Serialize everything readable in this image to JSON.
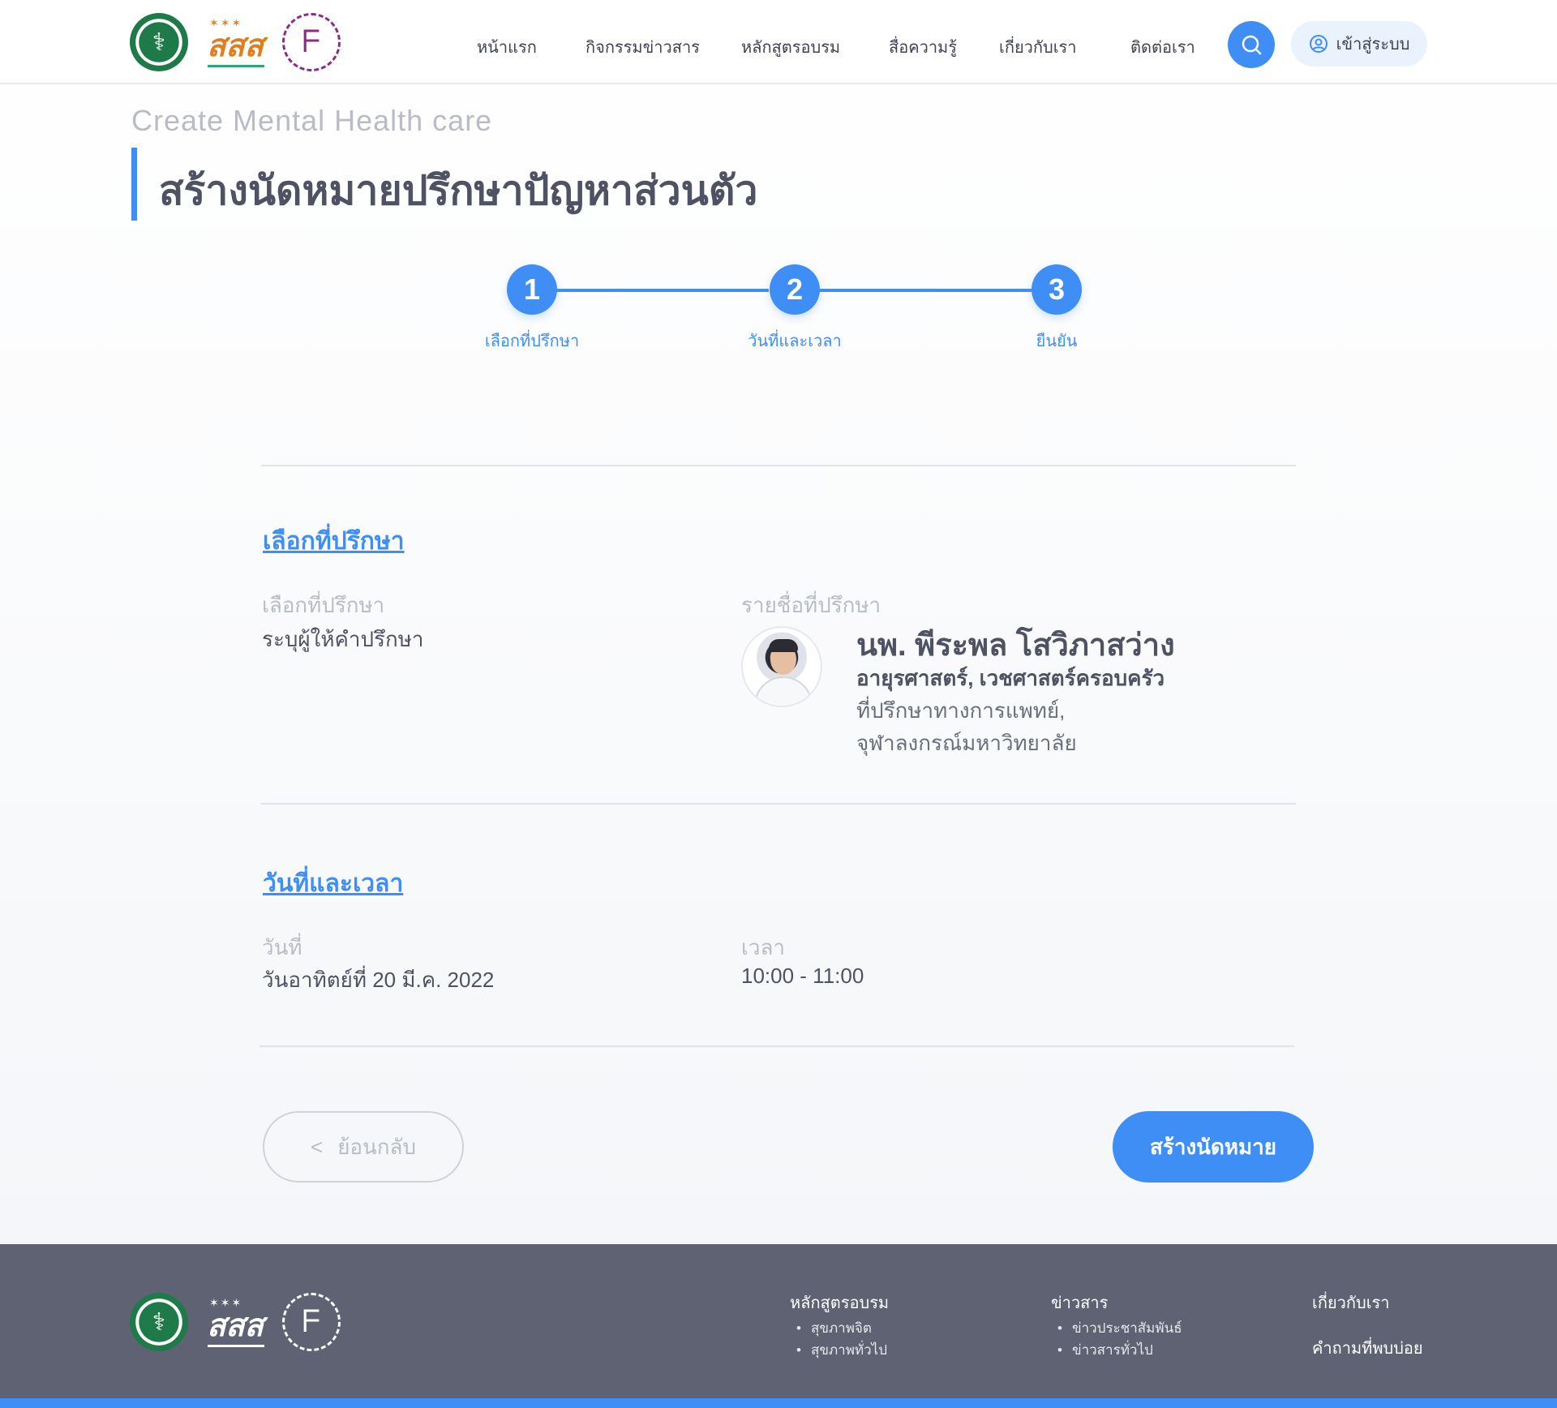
{
  "header": {
    "nav": [
      "หน้าแรก",
      "กิจกรรมข่าวสาร",
      "หลักสูตรอบรม",
      "สื่อความรู้",
      "เกี่ยวกับเรา",
      "ติดต่อเรา"
    ],
    "login_label": "เข้าสู่ระบบ",
    "search_icon": "search-icon",
    "user_icon": "user-circle-icon"
  },
  "page": {
    "eyebrow": "Create Mental Health care",
    "title": "สร้างนัดหมายปรึกษาปัญหาส่วนตัว"
  },
  "stepper": {
    "steps": [
      {
        "number": "1",
        "label": "เลือกที่ปรึกษา"
      },
      {
        "number": "2",
        "label": "วันที่และเวลา"
      },
      {
        "number": "3",
        "label": "ยืนยัน"
      }
    ]
  },
  "consultant_section": {
    "title": "เลือกที่ปรึกษา",
    "choose_label": "เลือกที่ปรึกษา",
    "choose_value": "ระบุผู้ให้คำปรึกษา",
    "list_label": "รายชื่อที่ปรึกษา",
    "doctor": {
      "name": "นพ. พีระพล โสวิภาสว่าง",
      "specialty": "อายุรศาสตร์, เวชศาสตร์ครอบครัว",
      "role": "ที่ปรึกษาทางการแพทย์,",
      "organization": "จุฬาลงกรณ์มหาวิทยาลัย"
    }
  },
  "datetime_section": {
    "title": "วันที่และเวลา",
    "date_label": "วันที่",
    "date_value": "วันอาทิตย์ที่ 20 มี.ค. 2022",
    "time_label": "เวลา",
    "time_value": "10:00 - 11:00"
  },
  "actions": {
    "back_icon": "<",
    "back_label": "ย้อนกลับ",
    "create_label": "สร้างนัดหมาย"
  },
  "footer": {
    "col1": {
      "title": "หลักสูตรอบรม",
      "items": [
        "สุขภาพจิต",
        "สุขภาพทั่วไป"
      ]
    },
    "col2": {
      "title": "ข่าวสาร",
      "items": [
        "ข่าวประชาสัมพันธ์",
        "ข่าวสารทั่วไป"
      ]
    },
    "col3": {
      "title": "เกี่ยวกับเรา",
      "title2": "คำถามที่พบบ่อย"
    }
  },
  "colors": {
    "accent": "#3f8ef5",
    "footer_bg": "#5f6272",
    "text_dark": "#4e5262",
    "text_muted": "#b9bcc6"
  }
}
